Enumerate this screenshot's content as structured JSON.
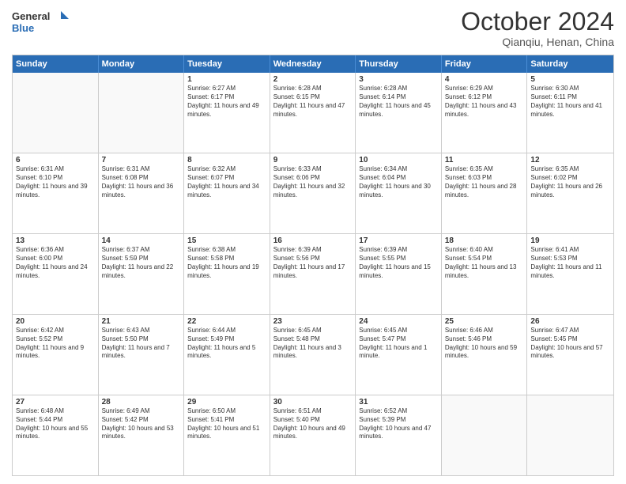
{
  "header": {
    "logo_line1": "General",
    "logo_line2": "Blue",
    "title": "October 2024",
    "subtitle": "Qianqiu, Henan, China"
  },
  "weekdays": [
    "Sunday",
    "Monday",
    "Tuesday",
    "Wednesday",
    "Thursday",
    "Friday",
    "Saturday"
  ],
  "weeks": [
    [
      {
        "day": "",
        "text": ""
      },
      {
        "day": "",
        "text": ""
      },
      {
        "day": "1",
        "text": "Sunrise: 6:27 AM\nSunset: 6:17 PM\nDaylight: 11 hours and 49 minutes."
      },
      {
        "day": "2",
        "text": "Sunrise: 6:28 AM\nSunset: 6:15 PM\nDaylight: 11 hours and 47 minutes."
      },
      {
        "day": "3",
        "text": "Sunrise: 6:28 AM\nSunset: 6:14 PM\nDaylight: 11 hours and 45 minutes."
      },
      {
        "day": "4",
        "text": "Sunrise: 6:29 AM\nSunset: 6:12 PM\nDaylight: 11 hours and 43 minutes."
      },
      {
        "day": "5",
        "text": "Sunrise: 6:30 AM\nSunset: 6:11 PM\nDaylight: 11 hours and 41 minutes."
      }
    ],
    [
      {
        "day": "6",
        "text": "Sunrise: 6:31 AM\nSunset: 6:10 PM\nDaylight: 11 hours and 39 minutes."
      },
      {
        "day": "7",
        "text": "Sunrise: 6:31 AM\nSunset: 6:08 PM\nDaylight: 11 hours and 36 minutes."
      },
      {
        "day": "8",
        "text": "Sunrise: 6:32 AM\nSunset: 6:07 PM\nDaylight: 11 hours and 34 minutes."
      },
      {
        "day": "9",
        "text": "Sunrise: 6:33 AM\nSunset: 6:06 PM\nDaylight: 11 hours and 32 minutes."
      },
      {
        "day": "10",
        "text": "Sunrise: 6:34 AM\nSunset: 6:04 PM\nDaylight: 11 hours and 30 minutes."
      },
      {
        "day": "11",
        "text": "Sunrise: 6:35 AM\nSunset: 6:03 PM\nDaylight: 11 hours and 28 minutes."
      },
      {
        "day": "12",
        "text": "Sunrise: 6:35 AM\nSunset: 6:02 PM\nDaylight: 11 hours and 26 minutes."
      }
    ],
    [
      {
        "day": "13",
        "text": "Sunrise: 6:36 AM\nSunset: 6:00 PM\nDaylight: 11 hours and 24 minutes."
      },
      {
        "day": "14",
        "text": "Sunrise: 6:37 AM\nSunset: 5:59 PM\nDaylight: 11 hours and 22 minutes."
      },
      {
        "day": "15",
        "text": "Sunrise: 6:38 AM\nSunset: 5:58 PM\nDaylight: 11 hours and 19 minutes."
      },
      {
        "day": "16",
        "text": "Sunrise: 6:39 AM\nSunset: 5:56 PM\nDaylight: 11 hours and 17 minutes."
      },
      {
        "day": "17",
        "text": "Sunrise: 6:39 AM\nSunset: 5:55 PM\nDaylight: 11 hours and 15 minutes."
      },
      {
        "day": "18",
        "text": "Sunrise: 6:40 AM\nSunset: 5:54 PM\nDaylight: 11 hours and 13 minutes."
      },
      {
        "day": "19",
        "text": "Sunrise: 6:41 AM\nSunset: 5:53 PM\nDaylight: 11 hours and 11 minutes."
      }
    ],
    [
      {
        "day": "20",
        "text": "Sunrise: 6:42 AM\nSunset: 5:52 PM\nDaylight: 11 hours and 9 minutes."
      },
      {
        "day": "21",
        "text": "Sunrise: 6:43 AM\nSunset: 5:50 PM\nDaylight: 11 hours and 7 minutes."
      },
      {
        "day": "22",
        "text": "Sunrise: 6:44 AM\nSunset: 5:49 PM\nDaylight: 11 hours and 5 minutes."
      },
      {
        "day": "23",
        "text": "Sunrise: 6:45 AM\nSunset: 5:48 PM\nDaylight: 11 hours and 3 minutes."
      },
      {
        "day": "24",
        "text": "Sunrise: 6:45 AM\nSunset: 5:47 PM\nDaylight: 11 hours and 1 minute."
      },
      {
        "day": "25",
        "text": "Sunrise: 6:46 AM\nSunset: 5:46 PM\nDaylight: 10 hours and 59 minutes."
      },
      {
        "day": "26",
        "text": "Sunrise: 6:47 AM\nSunset: 5:45 PM\nDaylight: 10 hours and 57 minutes."
      }
    ],
    [
      {
        "day": "27",
        "text": "Sunrise: 6:48 AM\nSunset: 5:44 PM\nDaylight: 10 hours and 55 minutes."
      },
      {
        "day": "28",
        "text": "Sunrise: 6:49 AM\nSunset: 5:42 PM\nDaylight: 10 hours and 53 minutes."
      },
      {
        "day": "29",
        "text": "Sunrise: 6:50 AM\nSunset: 5:41 PM\nDaylight: 10 hours and 51 minutes."
      },
      {
        "day": "30",
        "text": "Sunrise: 6:51 AM\nSunset: 5:40 PM\nDaylight: 10 hours and 49 minutes."
      },
      {
        "day": "31",
        "text": "Sunrise: 6:52 AM\nSunset: 5:39 PM\nDaylight: 10 hours and 47 minutes."
      },
      {
        "day": "",
        "text": ""
      },
      {
        "day": "",
        "text": ""
      }
    ]
  ]
}
